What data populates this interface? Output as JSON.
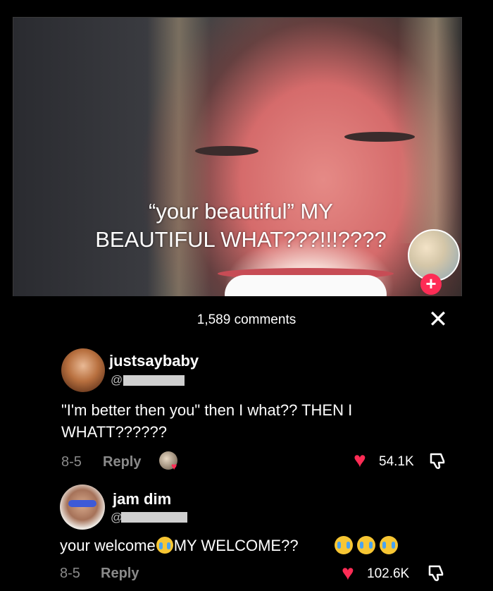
{
  "video": {
    "caption_line1": "“your beautiful” MY",
    "caption_line2": "BEAUTIFUL WHAT???!!!????",
    "follow_icon": "plus-icon"
  },
  "comments_panel": {
    "count_label": "1,589 comments",
    "close_icon": "close-icon"
  },
  "comments": [
    {
      "username": "justsaybaby",
      "handle": "@",
      "text_line1": "\"I'm better then you\" then I what?? THEN I",
      "text_line2": "WHATT??????",
      "date": "8-5",
      "reply_label": "Reply",
      "likes": "54.1K"
    },
    {
      "username": "jam dim",
      "handle": "@",
      "text_part1": "your welcome",
      "text_part2": "MY WELCOME??",
      "date": "8-5",
      "reply_label": "Reply",
      "likes": "102.6K"
    }
  ],
  "colors": {
    "accent": "#fe2c55",
    "background": "#000000",
    "meta_text": "#8a8a8a"
  }
}
